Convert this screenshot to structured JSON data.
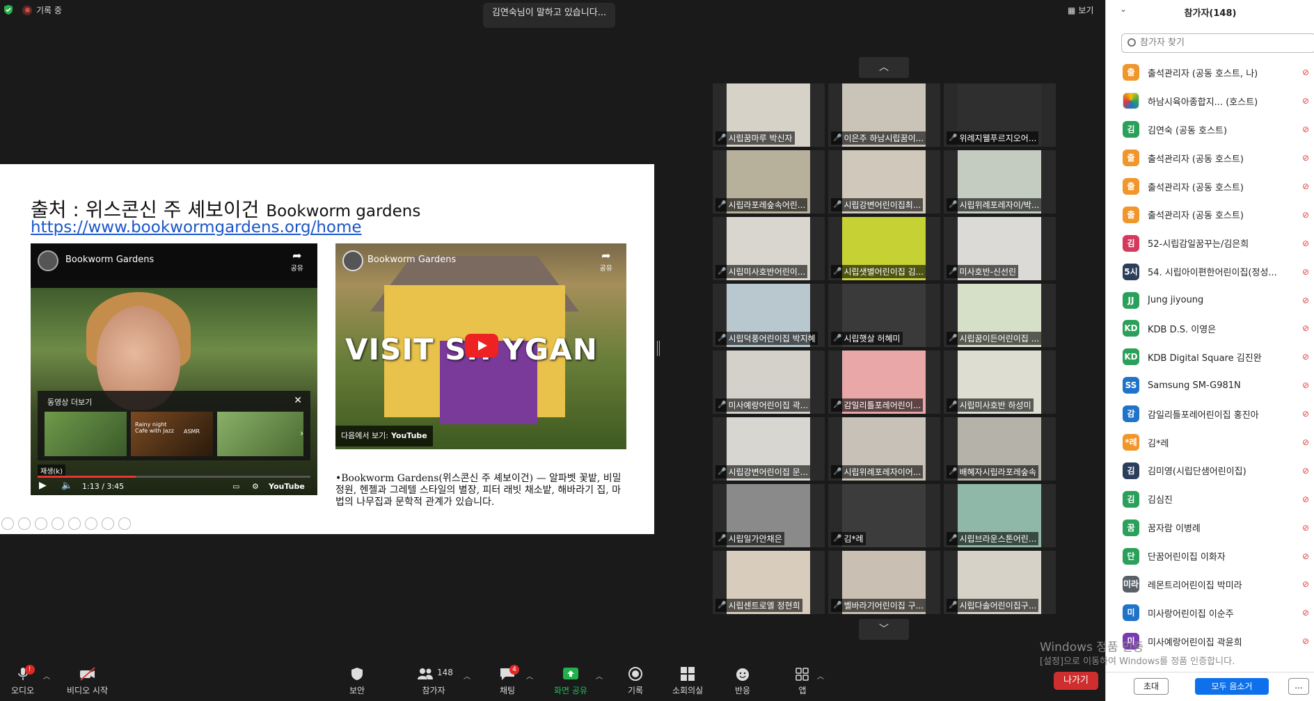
{
  "topbar": {
    "recording_label": "기록 중",
    "speaking_text": "김연숙님이 말하고 있습니다...",
    "view_label": "보기"
  },
  "slide": {
    "title_ko": "출처 : 위스콘신 주 셰보이건",
    "title_en": "Bookworm gardens",
    "link": "https://www.bookwormgardens.org/home",
    "video1": {
      "channel": "Bookworm Gardens",
      "share": "공유",
      "more_title": "동영상 더보기",
      "thumb2_text": "Rainy night Cafe with Jazz",
      "thumb2_badge": "ASMR",
      "play_tip": "재생(k)",
      "time": "1:13 / 3:45",
      "brand": "YouTube",
      "progress": 0.36
    },
    "video2": {
      "channel": "Bookworm Gardens",
      "share": "공유",
      "headline": "VISIT SH    YGAN",
      "next_label": "다음에서 보기:",
      "next_brand": "YouTube"
    },
    "body": "•Bookworm Gardens(위스콘신 주 셰보이건) — 알파벳 꽃밭, 비밀 정원, 헨젤과 그레텔 스타일의 별장, 피터 래빗 채소밭, 해바라기 집, 마법의 나무집과 문학적 관계가 있습니다."
  },
  "grid": {
    "tiles": [
      {
        "name": "시립꿈마루 박신자",
        "color": "#d7d2c8"
      },
      {
        "name": "이은주 하남시립꿈이...",
        "color": "#c9c3b8"
      },
      {
        "name": "위례지웰푸르지오어...",
        "color": "#2f2f2f"
      },
      {
        "name": "시립라포레숲속어린...",
        "color": "#b7b09a"
      },
      {
        "name": "시립강변어린이집최...",
        "color": "#cfc8bb"
      },
      {
        "name": "시립위례포레자이/박...",
        "color": "#c4ccc2"
      },
      {
        "name": "시립미사호반어린이...",
        "color": "#d9d6cf"
      },
      {
        "name": "시립샛별어린이집 김...",
        "color": "#c6d134"
      },
      {
        "name": "미사호반-신선린",
        "color": "#dcdad6"
      },
      {
        "name": "시립덕풍어린이집 박지혜",
        "color": "#b9c7cf"
      },
      {
        "name": "시립햇살 허혜미",
        "color": "#3a3a3a"
      },
      {
        "name": "시립꿈이든어린이집 ...",
        "color": "#d6e0c8"
      },
      {
        "name": "미사예랑어린이집 곽...",
        "color": "#d4d0ca"
      },
      {
        "name": "감일리틀포레어린이...",
        "color": "#e9a7a7"
      },
      {
        "name": "시립미사호반 하성미",
        "color": "#ddddd2"
      },
      {
        "name": "시립강변어린이집 문...",
        "color": "#d8d6d0"
      },
      {
        "name": "시립위례포레자이어...",
        "color": "#c7c1b7"
      },
      {
        "name": "배혜자시립라포레숲속",
        "color": "#b5b2a9"
      },
      {
        "name": "시립일가안채은",
        "color": "#8a8a8a"
      },
      {
        "name": "김*례",
        "color": "#3c3c3c"
      },
      {
        "name": "시립브라운스톤어린...",
        "color": "#8fb8a8"
      },
      {
        "name": "시립센트로엘 정현희",
        "color": "#d8ccbc"
      },
      {
        "name": "벨바라기어린이집 구...",
        "color": "#c9bfb2"
      },
      {
        "name": "시립다솔어린이집구...",
        "color": "#d6d2c7"
      }
    ]
  },
  "toolbar": {
    "audio": "오디오",
    "video": "비디오 시작",
    "security": "보안",
    "participants": "참가자",
    "participants_count": "148",
    "chat": "채팅",
    "chat_badge": "4",
    "share": "화면 공유",
    "record": "기록",
    "breakout": "소회의실",
    "reactions": "반응",
    "apps": "앱",
    "leave": "나가기",
    "audio_badge": "!"
  },
  "watermark": {
    "line1": "Windows 정품 인증",
    "line2": "[설정]으로 이동하여 Windows를 정품 인증합니다."
  },
  "panel": {
    "title": "참가자(148)",
    "search_placeholder": "참가자 찾기",
    "invite": "초대",
    "mute_all": "모두 음소거",
    "more": "...",
    "participants": [
      {
        "avatar": "출",
        "name": "출석관리자 (공동 호스트, 나)",
        "color": "#f0962b"
      },
      {
        "avatar": "",
        "name": "하남시육아종합지... (호스트)",
        "color": "#ffffff"
      },
      {
        "avatar": "김",
        "name": "김연숙 (공동 호스트)",
        "color": "#2ba05a"
      },
      {
        "avatar": "출",
        "name": "출석관리자 (공동 호스트)",
        "color": "#f0962b"
      },
      {
        "avatar": "출",
        "name": "출석관리자 (공동 호스트)",
        "color": "#f0962b"
      },
      {
        "avatar": "출",
        "name": "출석관리자 (공동 호스트)",
        "color": "#f0962b"
      },
      {
        "avatar": "김",
        "name": "52-시립감일꿈꾸는/김은희",
        "color": "#d53a5e"
      },
      {
        "avatar": "5시",
        "name": "54. 시립아이편한어린이집(정성...",
        "color": "#2c3e5a"
      },
      {
        "avatar": "JJ",
        "name": "Jung jiyoung",
        "color": "#2ba05a"
      },
      {
        "avatar": "KD",
        "name": "KDB D.S. 이영은",
        "color": "#2ba05a"
      },
      {
        "avatar": "KD",
        "name": "KDB Digital Square 김진완",
        "color": "#2ba05a"
      },
      {
        "avatar": "SS",
        "name": "Samsung SM-G981N",
        "color": "#1f73c9"
      },
      {
        "avatar": "감",
        "name": "감일리틀포레어린이집 홍진아",
        "color": "#1f73c9"
      },
      {
        "avatar": "*레",
        "name": "김*레",
        "color": "#f0962b"
      },
      {
        "avatar": "김",
        "name": "김미영(시립단샘어린이집)",
        "color": "#2c3e5a"
      },
      {
        "avatar": "김",
        "name": "김심진",
        "color": "#2ba05a"
      },
      {
        "avatar": "꿈",
        "name": "꿈자람 이병례",
        "color": "#2ba05a"
      },
      {
        "avatar": "단",
        "name": "단꿈어린이집 이화자",
        "color": "#2ba05a"
      },
      {
        "avatar": "미라",
        "name": "레몬트리어린이집 박미라",
        "color": "#5a6068"
      },
      {
        "avatar": "미",
        "name": "미사랑어린이집 이순주",
        "color": "#1f73c9"
      },
      {
        "avatar": "미",
        "name": "미사예랑어린이집 곽윤희",
        "color": "#7a3ab0"
      }
    ]
  }
}
